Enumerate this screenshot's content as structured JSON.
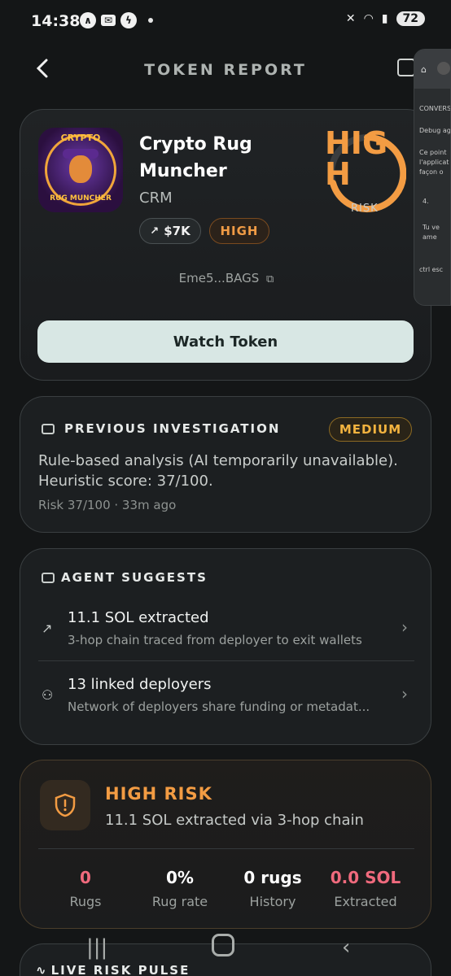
{
  "status_bar": {
    "time": "14:38",
    "battery": "72",
    "notif_icons": [
      "ticktick-icon",
      "mail-icon",
      "bolt-icon"
    ],
    "network": "6"
  },
  "header": {
    "title": "TOKEN REPORT"
  },
  "token": {
    "name": "Crypto Rug Muncher",
    "symbol": "CRM",
    "market_cap": "$7K",
    "risk_badge": "HIGH",
    "gauge_text": "HIGH",
    "gauge_label": "RISK",
    "address": "Eme5...BAGS",
    "watch_label": "Watch Token",
    "logo_top": "CRYPTO",
    "logo_bottom": "RUG MUNCHER"
  },
  "previous_investigation": {
    "title": "PREVIOUS INVESTIGATION",
    "badge": "MEDIUM",
    "text": "Rule-based analysis (AI temporarily unavailable). Heuristic score: 37/100.",
    "meta": "Risk 37/100 · 33m ago"
  },
  "agent_suggests": {
    "title": "AGENT SUGGESTS",
    "items": [
      {
        "icon": "arrow-up-right-icon",
        "title": "11.1 SOL extracted",
        "desc": "3-hop chain traced from deployer to exit wallets"
      },
      {
        "icon": "users-icon",
        "title": "13 linked deployers",
        "desc": "Network of deployers share funding or metadat..."
      }
    ]
  },
  "risk_summary": {
    "title": "HIGH RISK",
    "desc": "11.1 SOL extracted via 3-hop chain",
    "stats": [
      {
        "value": "0",
        "label": "Rugs",
        "color": "#f06a7d"
      },
      {
        "value": "0%",
        "label": "Rug rate",
        "color": "#ffffff"
      },
      {
        "value": "0 rugs",
        "label": "History",
        "color": "#ffffff"
      },
      {
        "value": "0.0 SOL",
        "label": "Extracted",
        "color": "#f06a7d"
      }
    ]
  },
  "live_pulse": {
    "title": "LIVE RISK PULSE"
  },
  "overlay_window": {
    "rows": [
      "CONVERSA",
      "Debug agen",
      "Ce point",
      "l'applicat",
      "façon o",
      "4.",
      "Tu ve",
      "ame",
      "ctrl esc"
    ]
  },
  "colors": {
    "accent_orange": "#f39c43",
    "accent_red": "#f06a7d",
    "button_bg": "#d8e7e4"
  }
}
